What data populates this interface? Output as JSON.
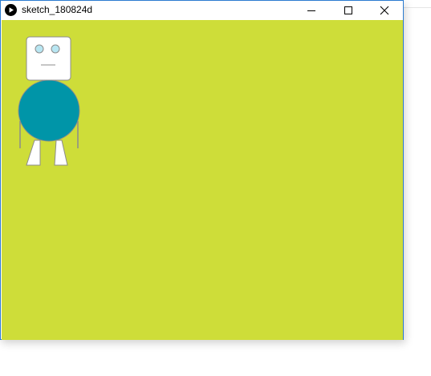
{
  "window": {
    "title": "sketch_180824d",
    "controls": {
      "minimize_icon": "minimize-icon",
      "maximize_icon": "maximize-icon",
      "close_icon": "close-icon"
    }
  },
  "sketch": {
    "background_color": "#cedd39",
    "robot": {
      "head_color": "#ffffff",
      "eye_color": "#b8e6f2",
      "body_color": "#0095a8",
      "leg_color": "#ffffff",
      "outline_color": "#8c8c8c"
    }
  }
}
